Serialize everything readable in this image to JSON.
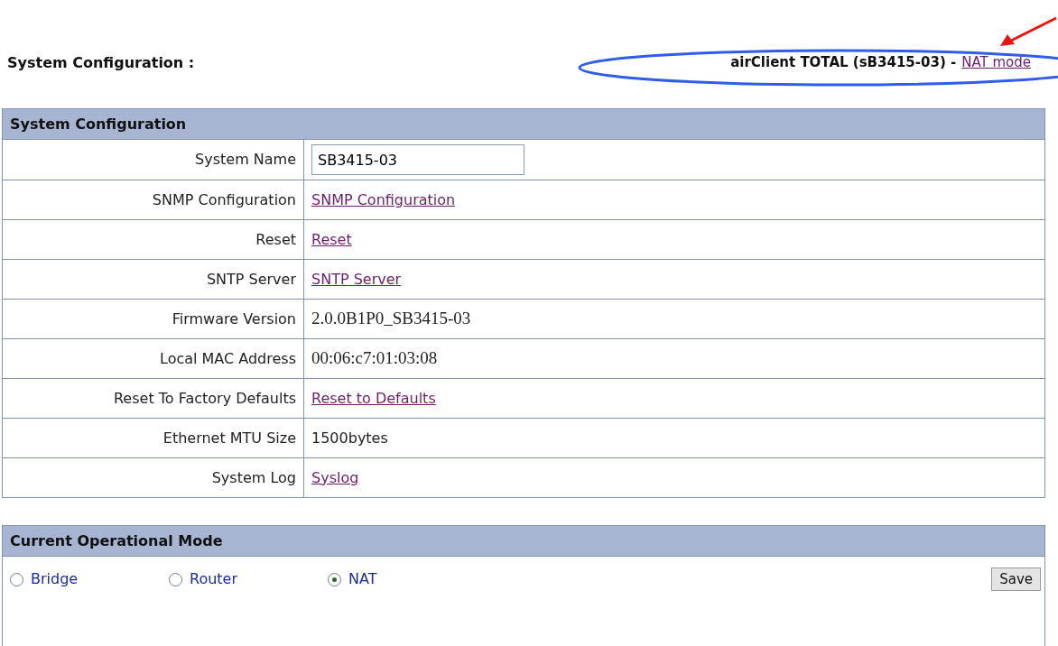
{
  "page_title": "System Configuration :",
  "device": {
    "label": "airClient TOTAL (sB3415-03) -",
    "mode_link": "NAT mode"
  },
  "config_panel": {
    "title": "System Configuration",
    "rows": [
      {
        "label": "System Name",
        "kind": "input",
        "value": "SB3415-03"
      },
      {
        "label": "SNMP Configuration",
        "kind": "link",
        "value": "SNMP Configuration"
      },
      {
        "label": "Reset",
        "kind": "link",
        "value": "Reset"
      },
      {
        "label": "SNTP Server",
        "kind": "link",
        "value": "SNTP Server"
      },
      {
        "label": "Firmware Version",
        "kind": "serif",
        "value": "2.0.0B1P0_SB3415-03"
      },
      {
        "label": "Local MAC Address",
        "kind": "serif",
        "value": "00:06:c7:01:03:08"
      },
      {
        "label": "Reset To Factory Defaults",
        "kind": "link",
        "value": "Reset to Defaults"
      },
      {
        "label": "Ethernet MTU Size",
        "kind": "text",
        "value": "1500bytes"
      },
      {
        "label": "System Log",
        "kind": "link",
        "value": "Syslog"
      }
    ]
  },
  "mode_panel": {
    "title": "Current Operational Mode",
    "options": [
      {
        "label": "Bridge",
        "selected": false
      },
      {
        "label": "Router",
        "selected": false
      },
      {
        "label": "NAT",
        "selected": true
      }
    ],
    "save_button": "Save"
  }
}
